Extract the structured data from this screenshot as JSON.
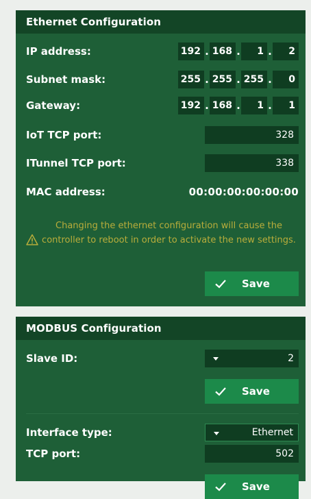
{
  "ethernet": {
    "title": "Ethernet Configuration",
    "ip_address": {
      "label": "IP address:",
      "octets": [
        "192",
        "168",
        "1",
        "2"
      ]
    },
    "subnet_mask": {
      "label": "Subnet mask:",
      "octets": [
        "255",
        "255",
        "255",
        "0"
      ]
    },
    "gateway": {
      "label": "Gateway:",
      "octets": [
        "192",
        "168",
        "1",
        "1"
      ]
    },
    "iot_tcp_port": {
      "label": "IoT TCP port:",
      "value": "328"
    },
    "itunnel_tcp_port": {
      "label": "ITunnel TCP port:",
      "value": "338"
    },
    "mac_address": {
      "label": "MAC address:",
      "value": "00:00:00:00:00:00"
    },
    "warning": "Changing the ethernet configuration will cause the controller to reboot in order to activate the new settings.",
    "save_label": "Save"
  },
  "modbus": {
    "title": "MODBUS Configuration",
    "slave_id": {
      "label": "Slave ID:",
      "value": "2"
    },
    "save_label": "Save",
    "interface_type": {
      "label": "Interface type:",
      "value": "Ethernet"
    },
    "tcp_port": {
      "label": "TCP port:",
      "value": "502"
    },
    "save2_label": "Save"
  },
  "colors": {
    "page_bg": "#ecefec",
    "panel_bg": "#1e5f37",
    "header_bg": "#134526",
    "field_bg": "#0f3d21",
    "button_bg": "#1c8a4a",
    "warning_text": "#b9ad3b"
  },
  "icons": {
    "warning": "warning-triangle-icon",
    "check": "check-icon",
    "dropdown": "caret-down-icon"
  }
}
